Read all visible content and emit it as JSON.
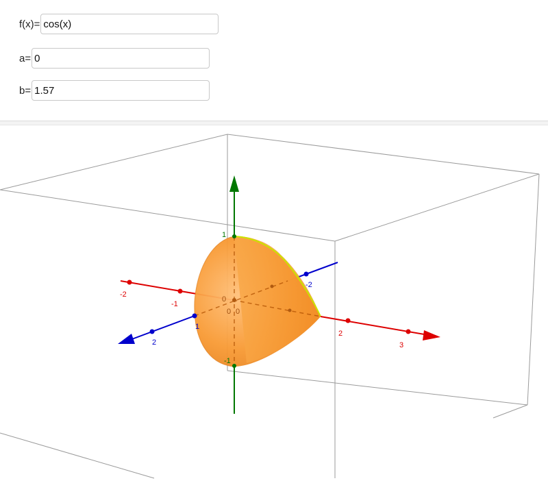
{
  "inputs": [
    {
      "label": "f(x)=",
      "value": "cos(x)"
    },
    {
      "label": "a=",
      "value": "0"
    },
    {
      "label": "b=",
      "value": "1.57"
    }
  ],
  "axes": {
    "x_color": "#dd0000",
    "y_color": "#0000cc",
    "z_color": "#007700",
    "x_ticks": [
      "-2",
      "-1",
      "2",
      "3"
    ],
    "y_ticks": [
      "-2",
      "1",
      "2"
    ],
    "z_ticks": [
      "1",
      "-1"
    ],
    "origin_labels": [
      "0",
      "0",
      "0"
    ]
  },
  "surface": {
    "fill": "#f59a30",
    "curve_color": "#c8e600"
  }
}
